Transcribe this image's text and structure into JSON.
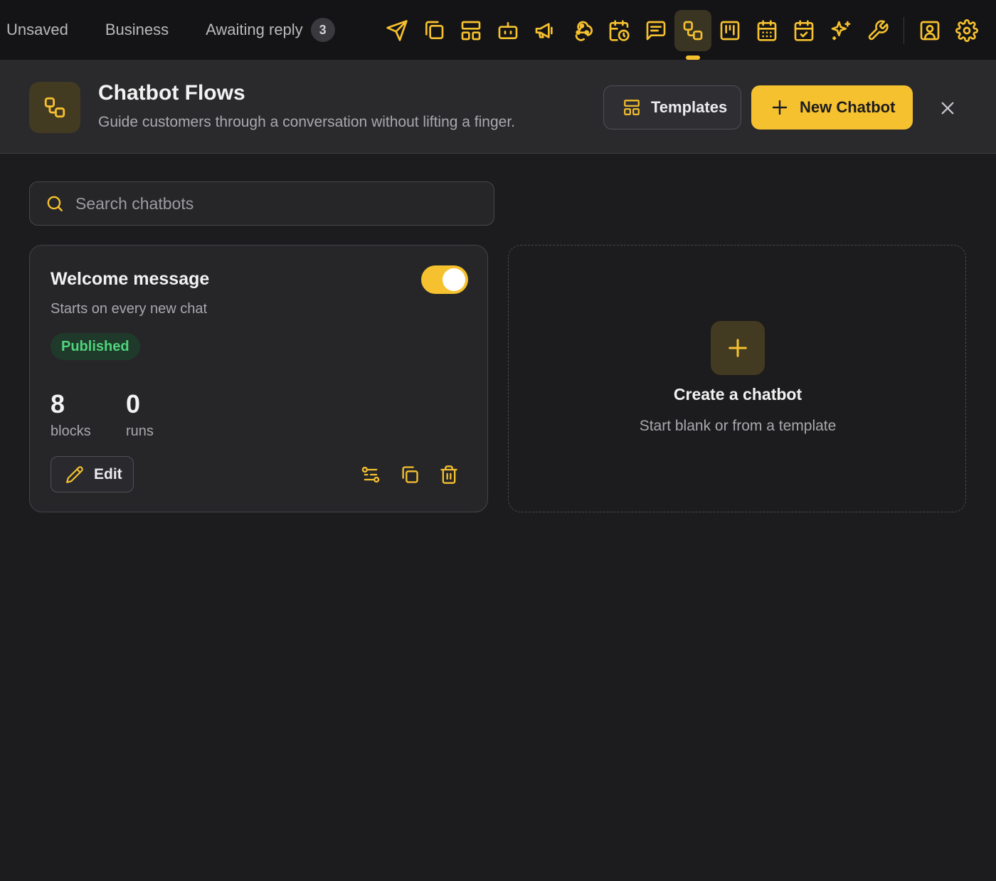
{
  "topbar": {
    "filters": [
      {
        "label": "Unsaved"
      },
      {
        "label": "Business"
      },
      {
        "label": "Awaiting reply",
        "count": "3"
      }
    ],
    "tools": [
      {
        "icon": "send-icon"
      },
      {
        "icon": "copy-icon"
      },
      {
        "icon": "layout-icon"
      },
      {
        "icon": "bot-icon"
      },
      {
        "icon": "megaphone-icon"
      },
      {
        "icon": "webhook-icon"
      },
      {
        "icon": "calendar-clock-icon"
      },
      {
        "icon": "message-icon"
      },
      {
        "icon": "workflow-icon",
        "active": true
      },
      {
        "icon": "kanban-icon"
      },
      {
        "icon": "calendar-grid-icon"
      },
      {
        "icon": "calendar-check-icon"
      },
      {
        "icon": "sparkles-icon"
      },
      {
        "icon": "wrench-icon"
      },
      {
        "icon": "contact-icon"
      },
      {
        "icon": "settings-icon"
      }
    ]
  },
  "header": {
    "icon": "workflow-icon",
    "title": "Chatbot Flows",
    "subtitle": "Guide customers through a conversation without lifting a finger.",
    "templates_label": "Templates",
    "new_label": "New Chatbot"
  },
  "search": {
    "placeholder": "Search chatbots",
    "value": ""
  },
  "chatbots": [
    {
      "title": "Welcome message",
      "description": "Starts on every new chat",
      "enabled": true,
      "status": "Published",
      "blocks": "8",
      "blocks_label": "blocks",
      "runs": "0",
      "runs_label": "runs",
      "edit_label": "Edit"
    }
  ],
  "create_card": {
    "title": "Create a chatbot",
    "subtitle": "Start blank or from a template"
  },
  "colors": {
    "accent": "#f6c12f",
    "background": "#1c1c1e",
    "published": "#4fd37c"
  }
}
